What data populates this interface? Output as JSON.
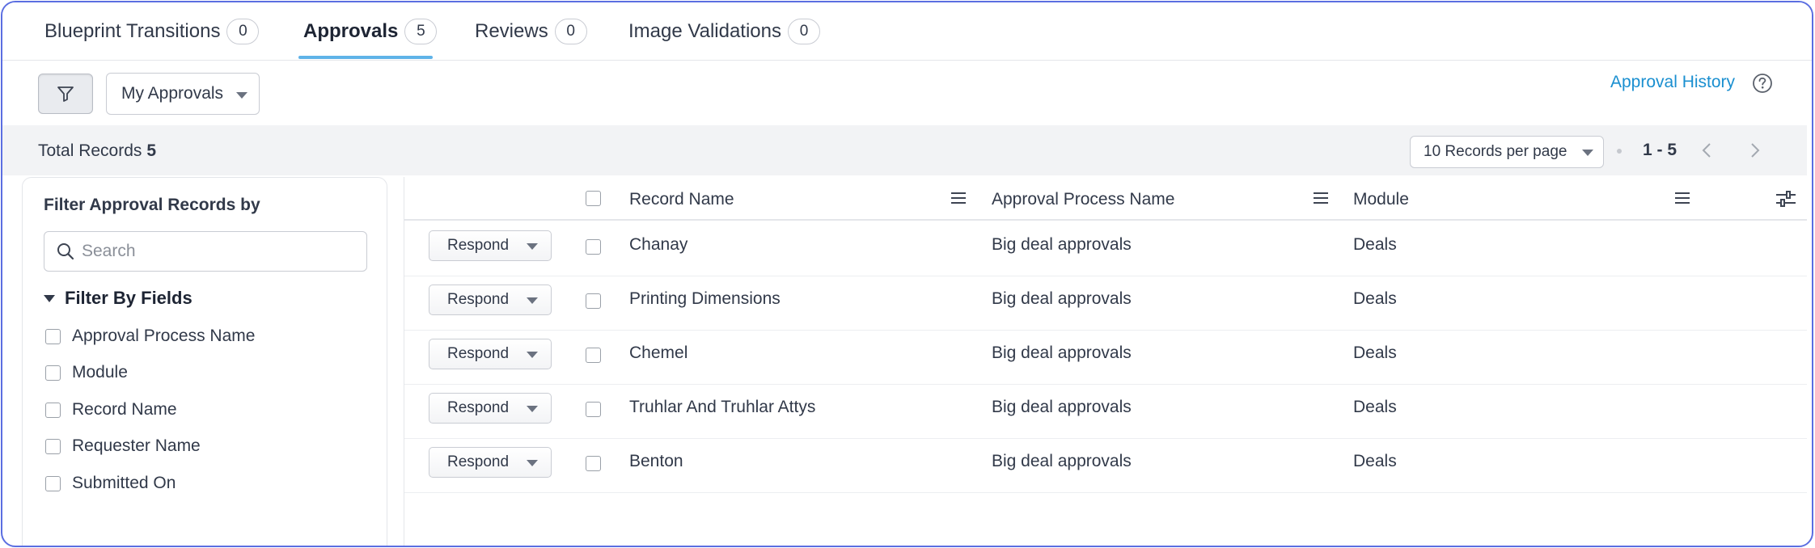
{
  "tabs": [
    {
      "label": "Blueprint Transitions",
      "count": "0"
    },
    {
      "label": "Approvals",
      "count": "5"
    },
    {
      "label": "Reviews",
      "count": "0"
    },
    {
      "label": "Image Validations",
      "count": "0"
    }
  ],
  "active_tab": "Approvals",
  "toolbar": {
    "view_select": "My Approvals",
    "approval_history_label": "Approval History"
  },
  "records_bar": {
    "total_label": "Total Records",
    "total_count": "5",
    "per_page": "10 Records per page",
    "range": "1 - 5"
  },
  "filter_panel": {
    "title": "Filter Approval Records by",
    "search_placeholder": "Search",
    "section_title": "Filter By Fields",
    "fields": [
      "Approval Process Name",
      "Module",
      "Record Name",
      "Requester Name",
      "Submitted On"
    ]
  },
  "table": {
    "columns": [
      "Record Name",
      "Approval Process Name",
      "Module"
    ],
    "action_label": "Respond",
    "rows": [
      {
        "record_name": "Chanay",
        "process": "Big deal approvals",
        "module": "Deals"
      },
      {
        "record_name": "Printing Dimensions",
        "process": "Big deal approvals",
        "module": "Deals"
      },
      {
        "record_name": "Chemel",
        "process": "Big deal approvals",
        "module": "Deals"
      },
      {
        "record_name": "Truhlar And Truhlar Attys",
        "process": "Big deal approvals",
        "module": "Deals"
      },
      {
        "record_name": "Benton",
        "process": "Big deal approvals",
        "module": "Deals"
      }
    ]
  },
  "colors": {
    "accent": "#5fb3e8",
    "link": "#1a8fd0",
    "frame_border": "#5b6ee1",
    "records_bar_bg": "#f2f3f5"
  }
}
